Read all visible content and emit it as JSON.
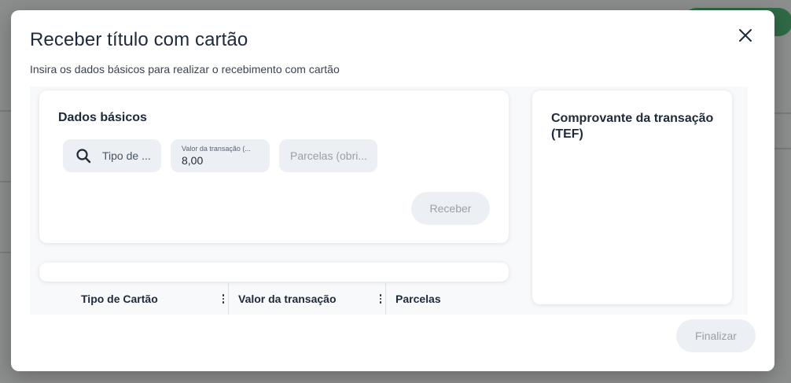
{
  "modal": {
    "title": "Receber título com cartão",
    "subtitle": "Insira os dados básicos para realizar o recebimento com cartão",
    "close_icon": "close-icon"
  },
  "basic_card": {
    "title": "Dados básicos",
    "tipo_cartao": {
      "placeholder": "Tipo de ...",
      "icon": "search-icon"
    },
    "valor_transacao": {
      "label": "Valor da transação (...",
      "value": "8,00"
    },
    "parcelas": {
      "placeholder": "Parcelas (obri..."
    },
    "receber_label": "Receber"
  },
  "table": {
    "columns": [
      "Tipo de Cartão",
      "Valor da transação",
      "Parcelas"
    ]
  },
  "tef_card": {
    "title": "Comprovante da transação (TEF)"
  },
  "footer": {
    "finalizar_label": "Finalizar"
  },
  "colors": {
    "backdrop": "#8c8d8d",
    "text_primary": "#1e2a3a",
    "field_bg": "#eceff4",
    "disabled_text": "#9aa1ab"
  }
}
